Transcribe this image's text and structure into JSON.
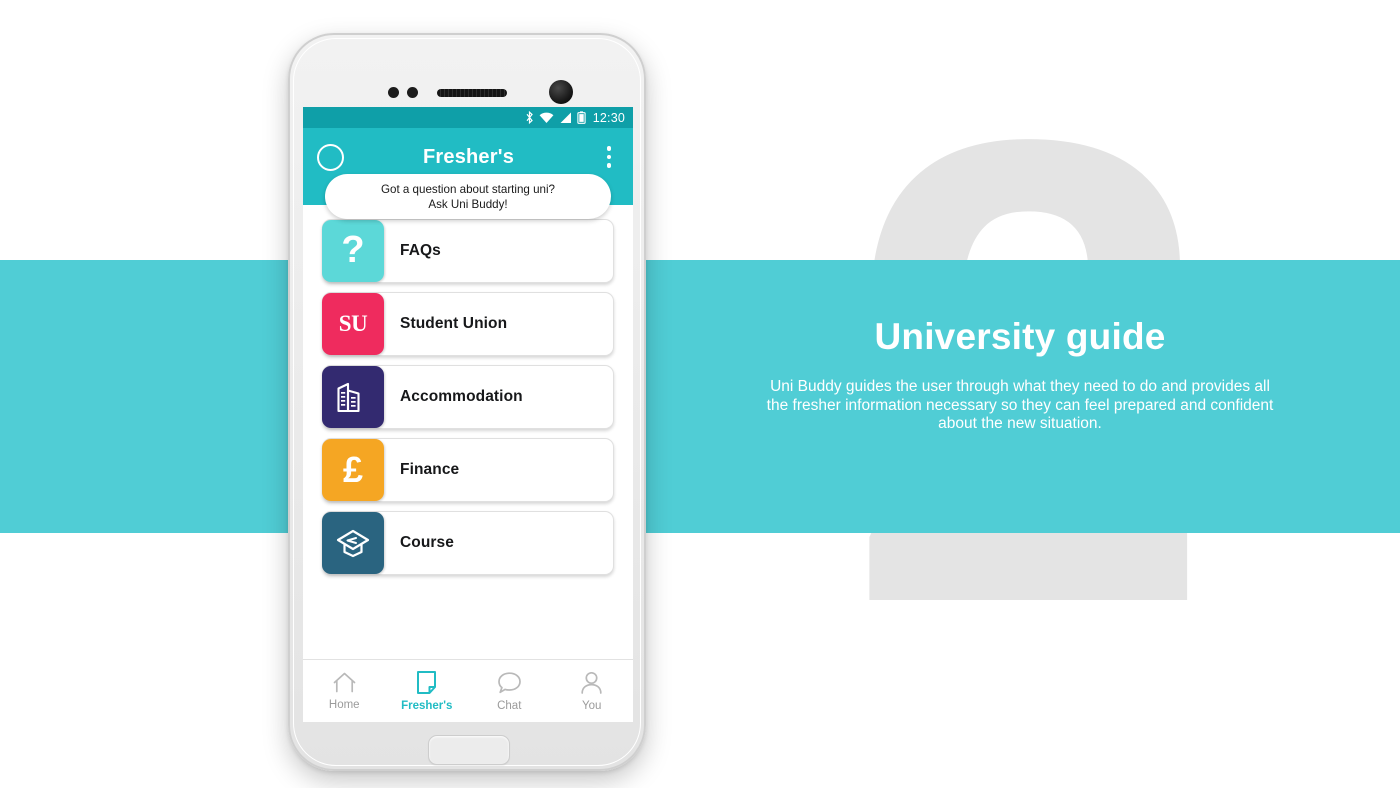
{
  "slide": {
    "number_watermark": "2",
    "title": "University guide",
    "body": "Uni Buddy guides the user through what they need to do and provides all the fresher information necessary so they can feel prepared and confident about the new situation.",
    "band_color": "#50cdd5",
    "watermark_color": "#e4e4e4"
  },
  "phone": {
    "status_bar": {
      "time": "12:30",
      "icons": [
        "bluetooth-icon",
        "wifi-icon",
        "cellular-signal-icon",
        "battery-icon"
      ],
      "background": "#0f9fa8"
    },
    "app_bar": {
      "title": "Fresher's",
      "avatar": "profile-circle-icon",
      "overflow": "overflow-menu-icon",
      "background": "#21bcc4"
    },
    "bubble": {
      "line1": "Got a question about starting uni?",
      "line2": "Ask Uni Buddy!"
    },
    "list": [
      {
        "label": "FAQs",
        "icon": "question-mark-icon",
        "glyph": "?",
        "color": "#5cd8d8"
      },
      {
        "label": "Student Union",
        "icon": "su-monogram-icon",
        "glyph": "SU",
        "color": "#ef2b5e"
      },
      {
        "label": "Accommodation",
        "icon": "buildings-icon",
        "glyph": "",
        "color": "#332a70"
      },
      {
        "label": "Finance",
        "icon": "pound-sterling-icon",
        "glyph": "£",
        "color": "#f5a623"
      },
      {
        "label": "Course",
        "icon": "graduation-cap-icon",
        "glyph": "",
        "color": "#2a6480"
      }
    ],
    "bottom_nav": [
      {
        "label": "Home",
        "icon": "home-icon",
        "active": false
      },
      {
        "label": "Fresher's",
        "icon": "document-icon",
        "active": true
      },
      {
        "label": "Chat",
        "icon": "chat-bubble-icon",
        "active": false
      },
      {
        "label": "You",
        "icon": "person-icon",
        "active": false
      }
    ],
    "accent_color": "#21bcc4"
  }
}
